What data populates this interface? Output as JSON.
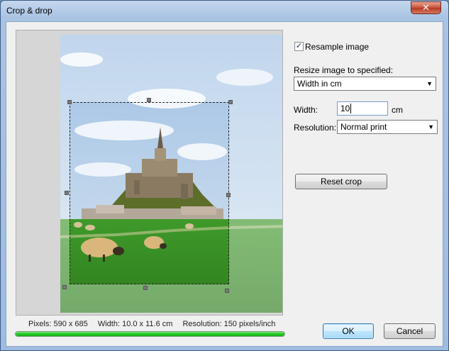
{
  "window": {
    "title": "Crop & drop",
    "close_glyph": "✕"
  },
  "preview": {
    "image_description": "Mont-Saint-Michel with sheep grazing in a green meadow"
  },
  "status": {
    "pixels": "Pixels: 590 x 685",
    "width": "Width: 10.0 x 11.6 cm",
    "resolution": "Resolution: 150 pixels/inch",
    "progress_fraction": 1.0
  },
  "options": {
    "resample_label": "Resample image",
    "resample_checked": true,
    "resize_label": "Resize image to specified:",
    "resize_value": "Width in cm",
    "width_label": "Width:",
    "width_value": "10",
    "width_unit": "cm",
    "resolution_label": "Resolution:",
    "resolution_value": "Normal print"
  },
  "buttons": {
    "reset_crop": "Reset crop",
    "ok": "OK",
    "cancel": "Cancel"
  },
  "icons": {
    "dropdown": "chevron-down-icon",
    "check": "checkmark-icon"
  },
  "colors": {
    "progress": "#1fcb1f",
    "title_close": "#c7503a"
  }
}
